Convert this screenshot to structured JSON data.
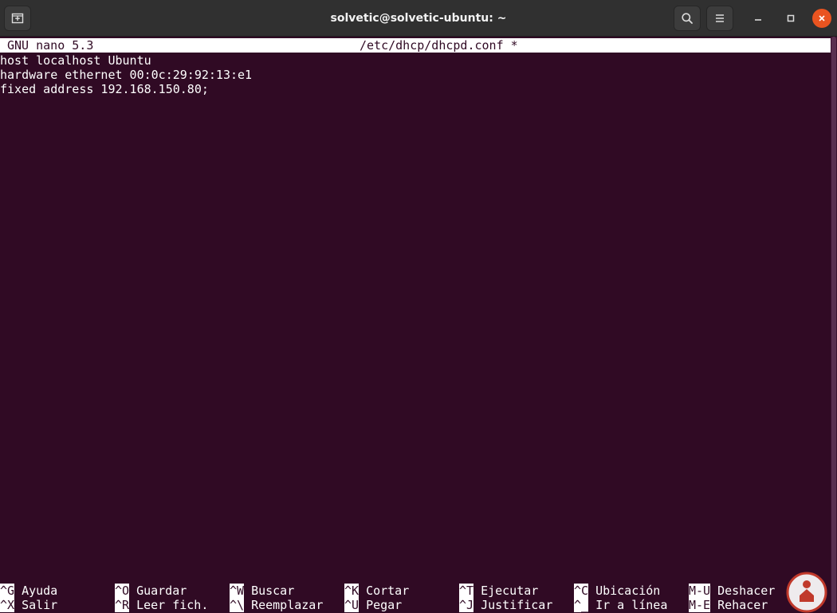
{
  "window": {
    "title": "solvetic@solvetic-ubuntu: ~"
  },
  "titlebar": {
    "new_tab_icon": "new-tab-icon",
    "search_icon": "search-icon",
    "menu_icon": "hamburger-menu-icon",
    "minimize_icon": "minimize-icon",
    "maximize_icon": "maximize-icon",
    "close_icon": "close-icon",
    "close_color": "#e95420"
  },
  "nano": {
    "version": "GNU nano 5.3",
    "filename": "/etc/dhcp/dhcpd.conf *",
    "lines": [
      "host localhost Ubuntu",
      "hardware ethernet 00:0c:29:92:13:e1",
      "fixed address 192.168.150.80;"
    ],
    "shortcuts_row1": [
      {
        "key": "^G",
        "label": "Ayuda"
      },
      {
        "key": "^O",
        "label": "Guardar"
      },
      {
        "key": "^W",
        "label": "Buscar"
      },
      {
        "key": "^K",
        "label": "Cortar"
      },
      {
        "key": "^T",
        "label": "Ejecutar"
      },
      {
        "key": "^C",
        "label": "Ubicación"
      },
      {
        "key": "M-U",
        "label": "Deshacer"
      }
    ],
    "shortcuts_row2": [
      {
        "key": "^X",
        "label": "Salir"
      },
      {
        "key": "^R",
        "label": "Leer fich."
      },
      {
        "key": "^\\",
        "label": "Reemplazar"
      },
      {
        "key": "^U",
        "label": "Pegar"
      },
      {
        "key": "^J",
        "label": "Justificar"
      },
      {
        "key": "^_",
        "label": "Ir a línea"
      },
      {
        "key": "M-E",
        "label": "Rehacer"
      }
    ]
  },
  "colors": {
    "terminal_bg": "#300a24",
    "terminal_fg": "#ffffff",
    "titlebar_bg": "#303030",
    "accent": "#e95420"
  }
}
